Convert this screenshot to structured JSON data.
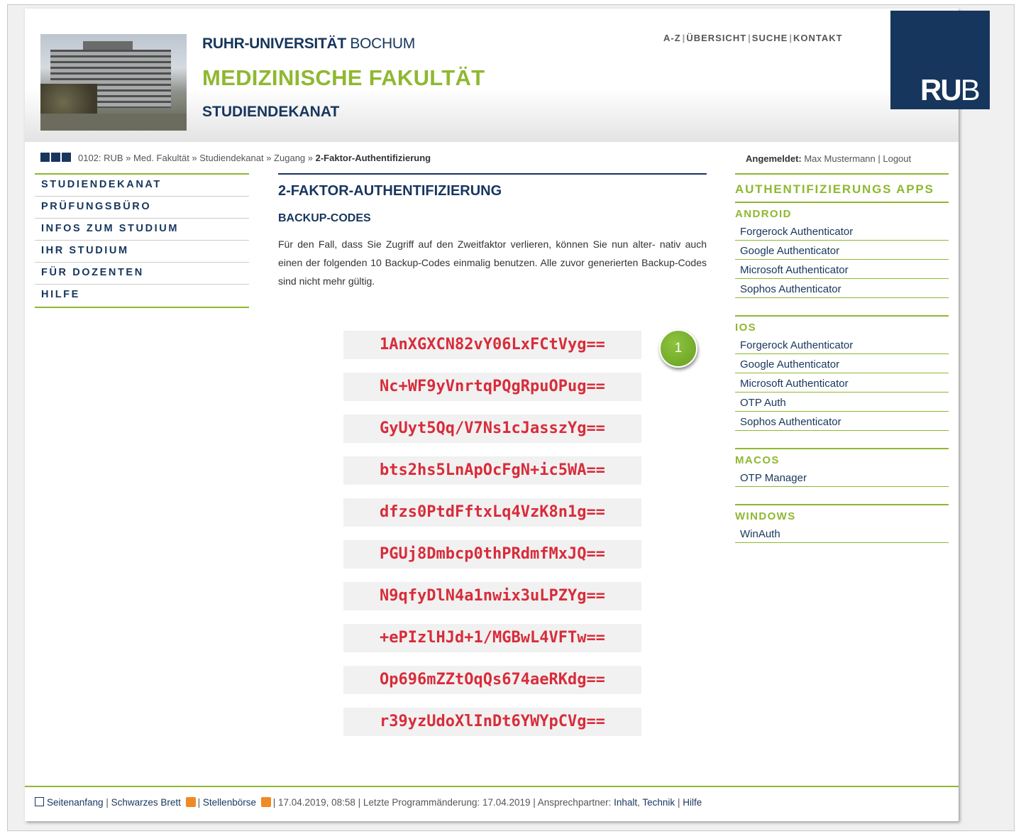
{
  "header": {
    "uni_bold": "RUHR-UNIVERSITÄT",
    "uni_rest": " BOCHUM",
    "faculty": "MEDIZINISCHE FAKULTÄT",
    "department": "STUDIENDEKANAT",
    "topnav": [
      "A-Z",
      "ÜBERSICHT",
      "SUCHE",
      "KONTAKT"
    ],
    "logo_bold": "RU",
    "logo_rest": "B"
  },
  "breadcrumb": {
    "prefix": "0102: RUB » Med. Fakultät » Studiendekanat » Zugang » ",
    "current": "2-Faktor-Authentifizierung"
  },
  "login": {
    "label": "Angemeldet:",
    "user": " Max Mustermann | Logout"
  },
  "leftnav": [
    "STUDIENDEKANAT",
    "PRÜFUNGSBÜRO",
    "INFOS ZUM STUDIUM",
    "IHR STUDIUM",
    "FÜR DOZENTEN",
    "HILFE"
  ],
  "main": {
    "title": "2-FAKTOR-AUTHENTIFIZIERUNG",
    "subtitle": "BACKUP-CODES",
    "text": "Für den Fall, dass Sie Zugriff auf den Zweitfaktor verlieren, können Sie nun alter- nativ auch einen der folgenden 10 Backup-Codes einmalig benutzen. Alle zuvor generierten Backup-Codes sind nicht mehr gültig.",
    "codes": [
      "1AnXGXCN82vY06LxFCtVyg==",
      "Nc+WF9yVnrtqPQgRpuOPug==",
      "GyUyt5Qq/V7Ns1cJasszYg==",
      "bts2hs5LnApOcFgN+ic5WA==",
      "dfzs0PtdFftxLq4VzK8n1g==",
      "PGUj8Dmbcp0thPRdmfMxJQ==",
      "N9qfyDlN4a1nwix3uLPZYg==",
      "+ePIzlHJd+1/MGBwL4VFTw==",
      "Op696mZZtOqQs674aeRKdg==",
      "r39yzUdoXlInDt6YWYpCVg=="
    ],
    "badge": "1"
  },
  "sidebar": {
    "title": "AUTHENTIFIZIERUNGS APPS",
    "android": {
      "label": "ANDROID",
      "items": [
        "Forgerock Authenticator",
        "Google Authenticator",
        "Microsoft Authenticator",
        "Sophos Authenticator"
      ]
    },
    "ios": {
      "label": "IOS",
      "items": [
        "Forgerock Authenticator",
        "Google Authenticator",
        "Microsoft Authenticator",
        "OTP Auth",
        "Sophos Authenticator"
      ]
    },
    "macos": {
      "label": "MACOS",
      "items": [
        "OTP Manager"
      ]
    },
    "windows": {
      "label": "WINDOWS",
      "items": [
        "WinAuth"
      ]
    }
  },
  "footer": {
    "seitenanfang": "Seitenanfang",
    "brett": "Schwarzes Brett",
    "boerse": "Stellenbörse",
    "date": "| 17.04.2019, 08:58 | Letzte Programmänderung: 17.04.2019 | Ansprechpartner: ",
    "inhalt": "Inhalt",
    "technik": "Technik",
    "hilfe": "Hilfe"
  },
  "colors": {
    "brand_blue": "#17365d",
    "accent_green": "#8fb831",
    "code_red": "#d82c3a"
  }
}
